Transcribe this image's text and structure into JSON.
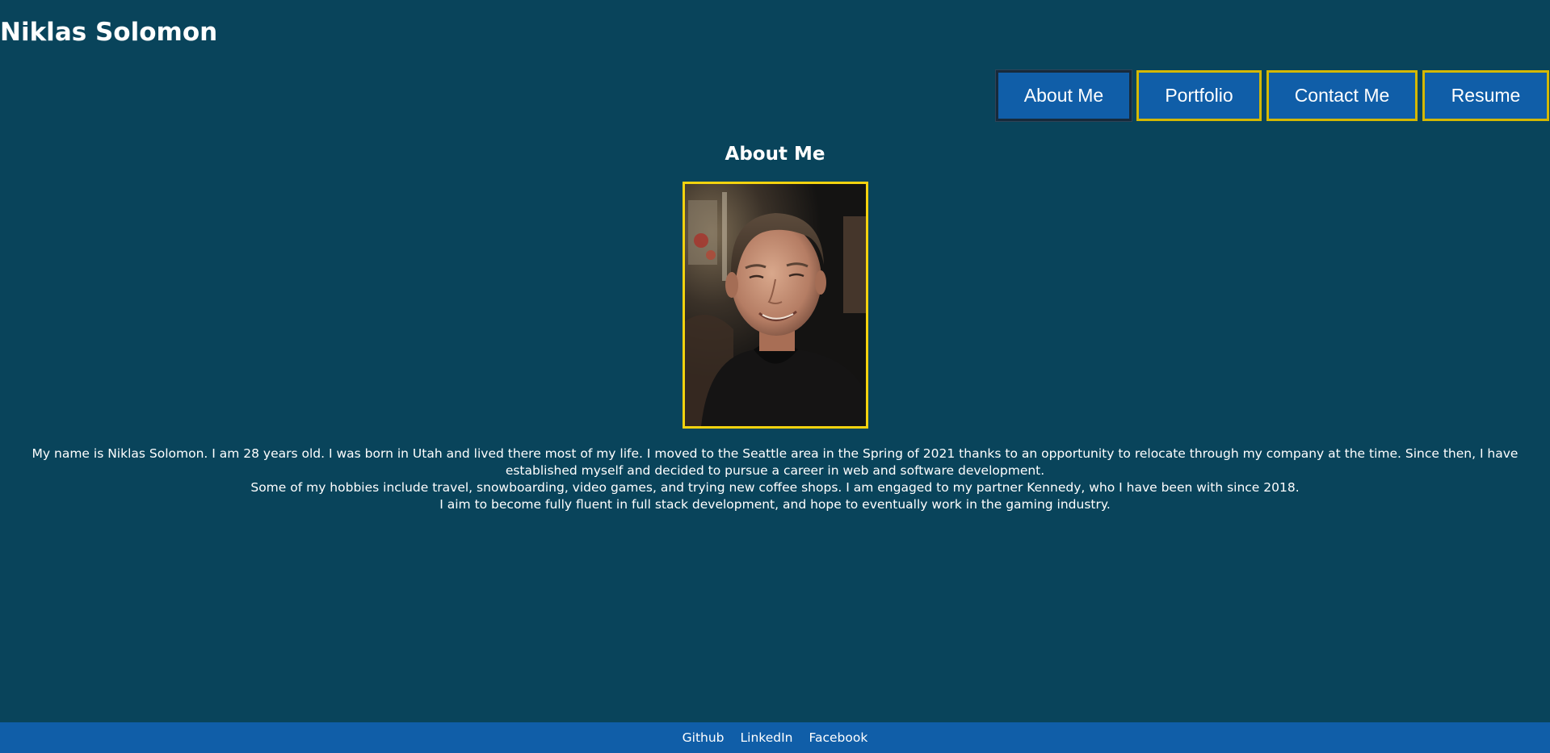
{
  "header": {
    "title": "Niklas Solomon"
  },
  "nav": {
    "items": [
      {
        "label": "About Me",
        "active": true
      },
      {
        "label": "Portfolio",
        "active": false
      },
      {
        "label": "Contact Me",
        "active": false
      },
      {
        "label": "Resume",
        "active": false
      }
    ]
  },
  "main": {
    "section_title": "About Me",
    "portrait_alt": "portrait",
    "bio": [
      "My name is Niklas Solomon. I am 28 years old. I was born in Utah and lived there most of my life. I moved to the Seattle area in the Spring of 2021 thanks to an opportunity to relocate through my company at the time. Since then, I have established myself and decided to pursue a career in web and software development.",
      "Some of my hobbies include travel, snowboarding, video games, and trying new coffee shops. I am engaged to my partner Kennedy, who I have been with since 2018.",
      "I aim to become fully fluent in full stack development, and hope to eventually work in the gaming industry."
    ]
  },
  "footer": {
    "links": [
      "Github",
      "LinkedIn",
      "Facebook"
    ]
  },
  "colors": {
    "background": "#09445b",
    "button_bg": "#105ea8",
    "button_border": "#d4b800",
    "active_border": "#172a3b",
    "portrait_border": "#f4d20f",
    "footer_bg": "#105ea8"
  }
}
